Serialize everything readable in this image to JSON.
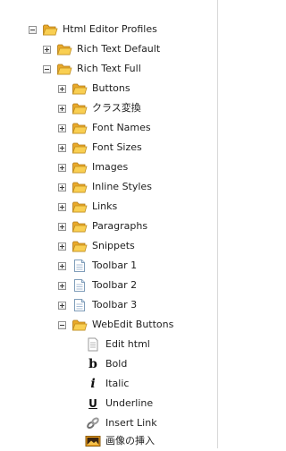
{
  "tree": {
    "root": {
      "label": "Html Editor Profiles",
      "expanded": true
    },
    "profiles": [
      {
        "label": "Rich Text Default",
        "expanded": false
      },
      {
        "label": "Rich Text Full",
        "expanded": true
      }
    ],
    "folders": [
      {
        "label": "Buttons"
      },
      {
        "label": "クラス変換"
      },
      {
        "label": "Font Names"
      },
      {
        "label": "Font Sizes"
      },
      {
        "label": "Images"
      },
      {
        "label": "Inline Styles"
      },
      {
        "label": "Links"
      },
      {
        "label": "Paragraphs"
      },
      {
        "label": "Snippets"
      }
    ],
    "toolbars": [
      {
        "label": "Toolbar 1"
      },
      {
        "label": "Toolbar 2"
      },
      {
        "label": "Toolbar 3"
      }
    ],
    "webedit": {
      "label": "WebEdit Buttons",
      "expanded": true
    },
    "buttons": [
      {
        "label": "Edit html",
        "icon": "document-icon"
      },
      {
        "label": "Bold",
        "icon": "bold-icon"
      },
      {
        "label": "Italic",
        "icon": "italic-icon"
      },
      {
        "label": "Underline",
        "icon": "underline-icon"
      },
      {
        "label": "Insert Link",
        "icon": "link-icon"
      },
      {
        "label": "画像の挿入",
        "icon": "image-icon"
      }
    ]
  },
  "colors": {
    "folder_front": "#f9cf52",
    "folder_back": "#e9a92a",
    "document": "#ffffff",
    "document_border": "#7f9db9",
    "expander_border": "#919191"
  }
}
